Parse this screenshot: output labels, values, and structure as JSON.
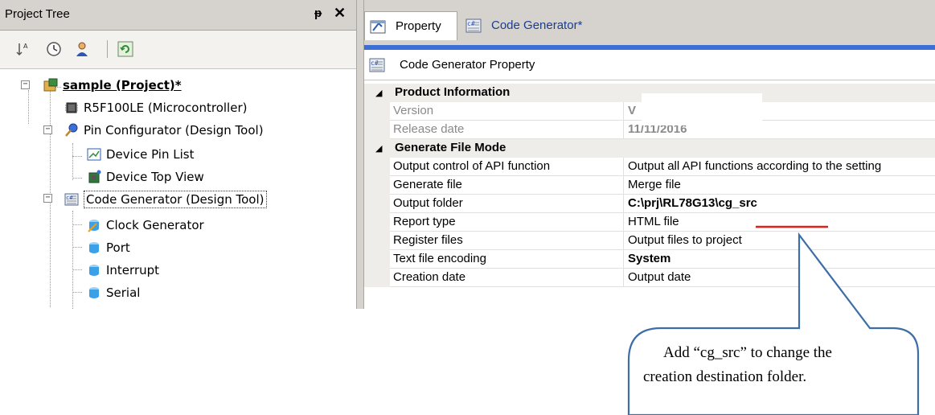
{
  "tree_pane": {
    "title": "Project Tree",
    "pin_glyph": "ᵽ",
    "close_glyph": "✕",
    "toolbar_icons": [
      "sort-icon",
      "clock-icon",
      "user-icon",
      "refresh-icon"
    ],
    "nodes": [
      {
        "label": "sample (Project)*",
        "icon": "project-icon",
        "bold": true,
        "expander": "−"
      },
      {
        "label": "R5F100LE (Microcontroller)",
        "icon": "chip-icon"
      },
      {
        "label": "Pin Configurator (Design Tool)",
        "icon": "pin-tool-icon",
        "expander": "−"
      },
      {
        "label": "Device Pin List",
        "icon": "pin-list-icon"
      },
      {
        "label": "Device Top View",
        "icon": "top-view-icon"
      },
      {
        "label": "Code Generator (Design Tool)",
        "icon": "code-generator-icon",
        "expander": "−",
        "selected": true
      },
      {
        "label": "Clock Generator",
        "icon": "module-icon"
      },
      {
        "label": "Port",
        "icon": "module-icon"
      },
      {
        "label": "Interrupt",
        "icon": "module-icon"
      },
      {
        "label": "Serial",
        "icon": "module-icon"
      }
    ]
  },
  "prop_pane": {
    "tabs": [
      {
        "label": "Property",
        "icon": "property-icon",
        "active": true
      },
      {
        "label": "Code Generator*",
        "icon": "code-generator-icon",
        "active": false
      }
    ],
    "header": "Code Generator Property",
    "categories": [
      {
        "name": "Product Information",
        "rows": [
          {
            "name": "Version",
            "value": "V",
            "dim": true
          },
          {
            "name": "Release date",
            "value": "11/11/2016",
            "dim": true
          }
        ]
      },
      {
        "name": "Generate File Mode",
        "rows": [
          {
            "name": "Output control of API function",
            "value": "Output all API functions according to the setting"
          },
          {
            "name": "Generate file",
            "value": "Merge file"
          },
          {
            "name": "Output folder",
            "value": "C:\\prj\\RL78G13\\cg_src",
            "bold": true
          },
          {
            "name": "Report type",
            "value": "HTML file"
          },
          {
            "name": "Register files",
            "value": "Output files to project"
          },
          {
            "name": "Text file encoding",
            "value": "System",
            "bold": true
          },
          {
            "name": "Creation date",
            "value": "Output date"
          }
        ]
      }
    ]
  },
  "callout": {
    "line1": "Add “cg_src” to change the",
    "line2": "creation destination folder.",
    "underline_color": "#e0201a",
    "border_color": "#3d6ea8"
  },
  "colors": {
    "tab_accent": "#3c6fd6",
    "chrome": "#d6d3ce",
    "tab_text": "#1b3d8f"
  }
}
